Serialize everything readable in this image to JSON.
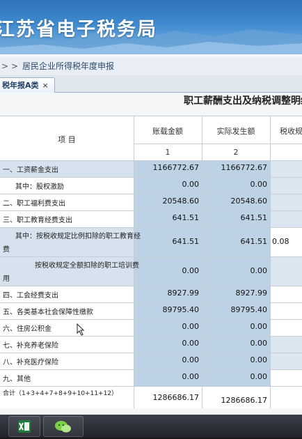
{
  "banner": {
    "title": "江苏省电子税务局"
  },
  "breadcrumb": {
    "sep": ">",
    "sep2": ">",
    "current": "居民企业所得税年度申报"
  },
  "tab": {
    "label": "税年报A类",
    "close": "×"
  },
  "report": {
    "title": "职工薪酬支出及纳税调整明细"
  },
  "table": {
    "headers": {
      "item": "项  目",
      "book_amount": "账载金额",
      "actual_amount": "实际发生额",
      "tax_limit": "税收规"
    },
    "col_numbers": {
      "col1": "1",
      "col2": "2"
    },
    "rows": [
      {
        "label": "一、工资薪金支出",
        "col1": "1166772.67",
        "col2": "1166772.67",
        "col3": ""
      },
      {
        "label": "其中：股权激励",
        "col1": "0.00",
        "col2": "0.00",
        "col3": ""
      },
      {
        "label": "二、职工福利费支出",
        "col1": "20548.60",
        "col2": "20548.60",
        "col3": ""
      },
      {
        "label": "三、职工教育经费支出",
        "col1": "641.51",
        "col2": "641.51",
        "col3": ""
      },
      {
        "label": "其中：按税收规定比例扣除的职工教育经",
        "label2": "费",
        "col1": "641.51",
        "col2": "641.51",
        "col3": "0.08"
      },
      {
        "label": "按税收规定全额扣除的职工培训费",
        "label2": "用",
        "col1": "0.00",
        "col2": "0.00",
        "col3": ""
      },
      {
        "label": "四、工会经费支出",
        "col1": "8927.99",
        "col2": "8927.99",
        "col3": ""
      },
      {
        "label": "五、各类基本社会保障性缴款",
        "col1": "89795.40",
        "col2": "89795.40",
        "col3": ""
      },
      {
        "label": "六、住房公积金",
        "col1": "0.00",
        "col2": "0.00",
        "col3": ""
      },
      {
        "label": "七、补充养老保险",
        "col1": "0.00",
        "col2": "0.00",
        "col3": ""
      },
      {
        "label": "八、补充医疗保险",
        "col1": "0.00",
        "col2": "0.00",
        "col3": ""
      },
      {
        "label": "九、其他",
        "col1": "0.00",
        "col2": "0.00",
        "col3": ""
      },
      {
        "label": "合计（1+3+4+7+8+9+10+11+12）",
        "col1": "1286686.17",
        "col2": "1286686.17",
        "col3": ""
      }
    ]
  },
  "taskbar": {
    "apps": [
      "excel-icon",
      "wechat-icon"
    ]
  },
  "colors": {
    "banner": "#3f8ad0",
    "input_cell": "#bed2e6",
    "header_bg": "#ffffff"
  }
}
